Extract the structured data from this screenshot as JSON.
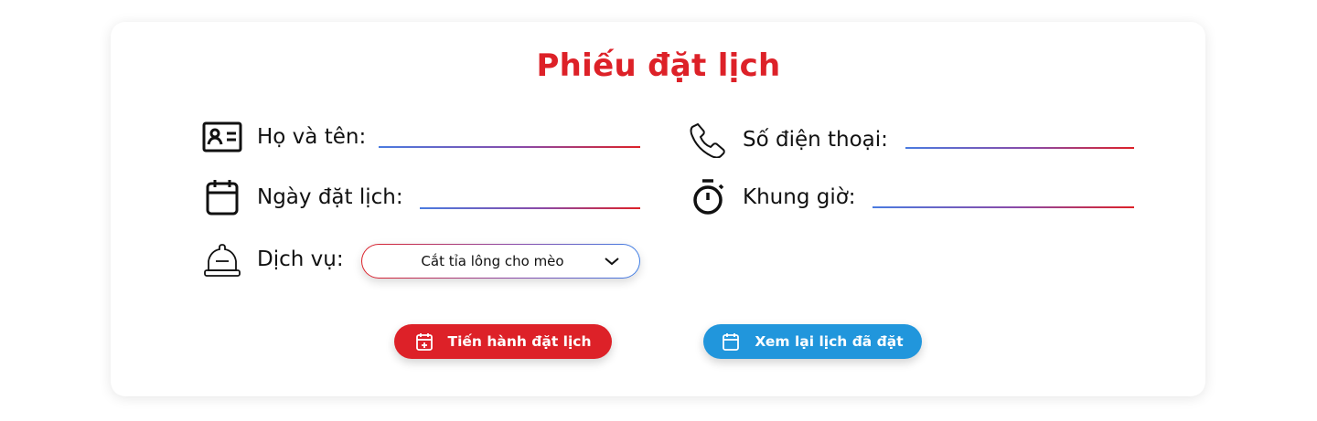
{
  "form": {
    "title": "Phiếu đặt lịch",
    "fields": {
      "name": {
        "label": "Họ và tên:",
        "value": "",
        "icon": "id-card-icon"
      },
      "phone": {
        "label": "Số điện thoại:",
        "value": "",
        "icon": "phone-icon"
      },
      "date": {
        "label": "Ngày đặt lịch:",
        "value": "",
        "icon": "calendar-icon"
      },
      "time": {
        "label": "Khung giờ:",
        "value": "",
        "icon": "stopwatch-icon"
      },
      "service": {
        "label": "Dịch vụ:",
        "selected": "Cắt tỉa lông cho mèo",
        "icon": "service-bell-icon"
      }
    },
    "buttons": {
      "submit": {
        "label": "Tiến hành đặt lịch",
        "icon": "calendar-plus-icon",
        "color": "#dd2128"
      },
      "review": {
        "label": "Xem lại lịch đã đặt",
        "icon": "calendar-icon",
        "color": "#2196dc"
      }
    },
    "colors": {
      "accent": "#dd2128",
      "blue": "#2196dc"
    }
  }
}
